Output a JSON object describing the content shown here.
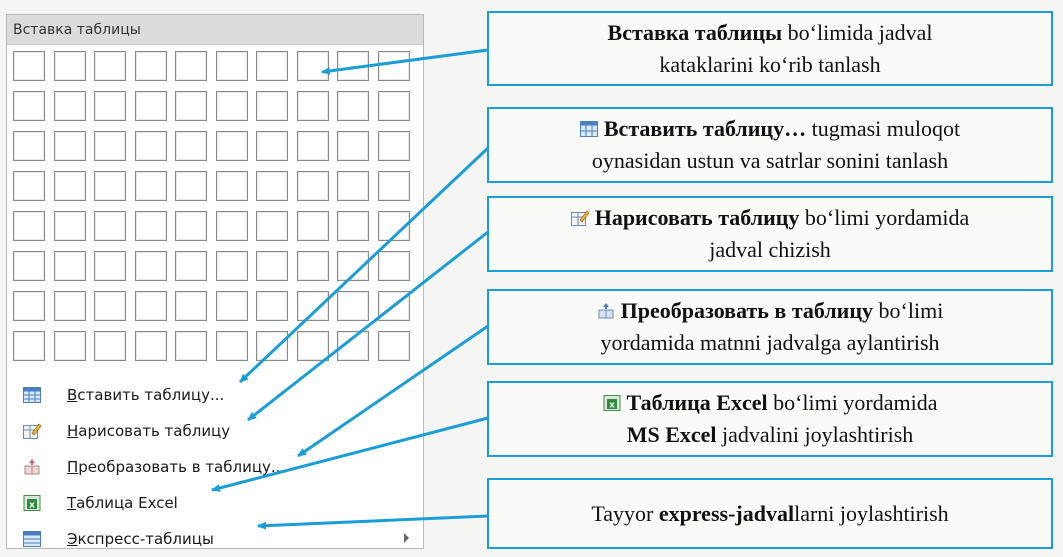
{
  "menu": {
    "header": "Вставка таблицы",
    "grid": {
      "cols": 10,
      "rows": 8
    },
    "items": [
      {
        "prefix": "",
        "underlined": "В",
        "rest": "ставить таблицу...",
        "icon": "insert-table-icon",
        "submenu": false
      },
      {
        "prefix": "",
        "underlined": "Н",
        "rest": "арисовать таблицу",
        "icon": "draw-table-icon",
        "submenu": false
      },
      {
        "prefix": "",
        "underlined": "П",
        "rest": "реобразовать в таблицу...",
        "icon": "convert-table-icon",
        "submenu": false
      },
      {
        "prefix": "",
        "underlined": "Т",
        "rest": "аблица Excel",
        "icon": "excel-table-icon",
        "submenu": false
      },
      {
        "prefix": "",
        "underlined": "Э",
        "rest": "кспресс-таблицы",
        "icon": "quick-tables-icon",
        "submenu": true
      }
    ]
  },
  "callouts": [
    {
      "bold": "Вставка таблицы",
      "text1": " bo‘limida jadval",
      "line2": "kataklarini ko‘rib tanlash"
    },
    {
      "bold": "Вставить таблицу…",
      "text1": " tugmasi muloqot",
      "line2": "oynasidan ustun va satrlar sonini tanlash"
    },
    {
      "bold": "Нарисовать таблицу",
      "text1": " bo‘limi yordamida",
      "line2": "jadval chizish"
    },
    {
      "bold": "Преобразовать в таблицу",
      "text1": " bo‘limi",
      "line2": "yordamida matnni jadvalga aylantirish"
    },
    {
      "bold": "Таблица Excel",
      "text1": " bo‘limi yordamida",
      "line2_bold": "MS Excel",
      "line2": " jadvalini joylashtirish"
    },
    {
      "text_pre": "Tayyor ",
      "bold": "express-jadval",
      "text1": "larni joylashtirish"
    }
  ],
  "colors": {
    "accent": "#1b9ed8",
    "header_bg": "#dcdcdc"
  }
}
